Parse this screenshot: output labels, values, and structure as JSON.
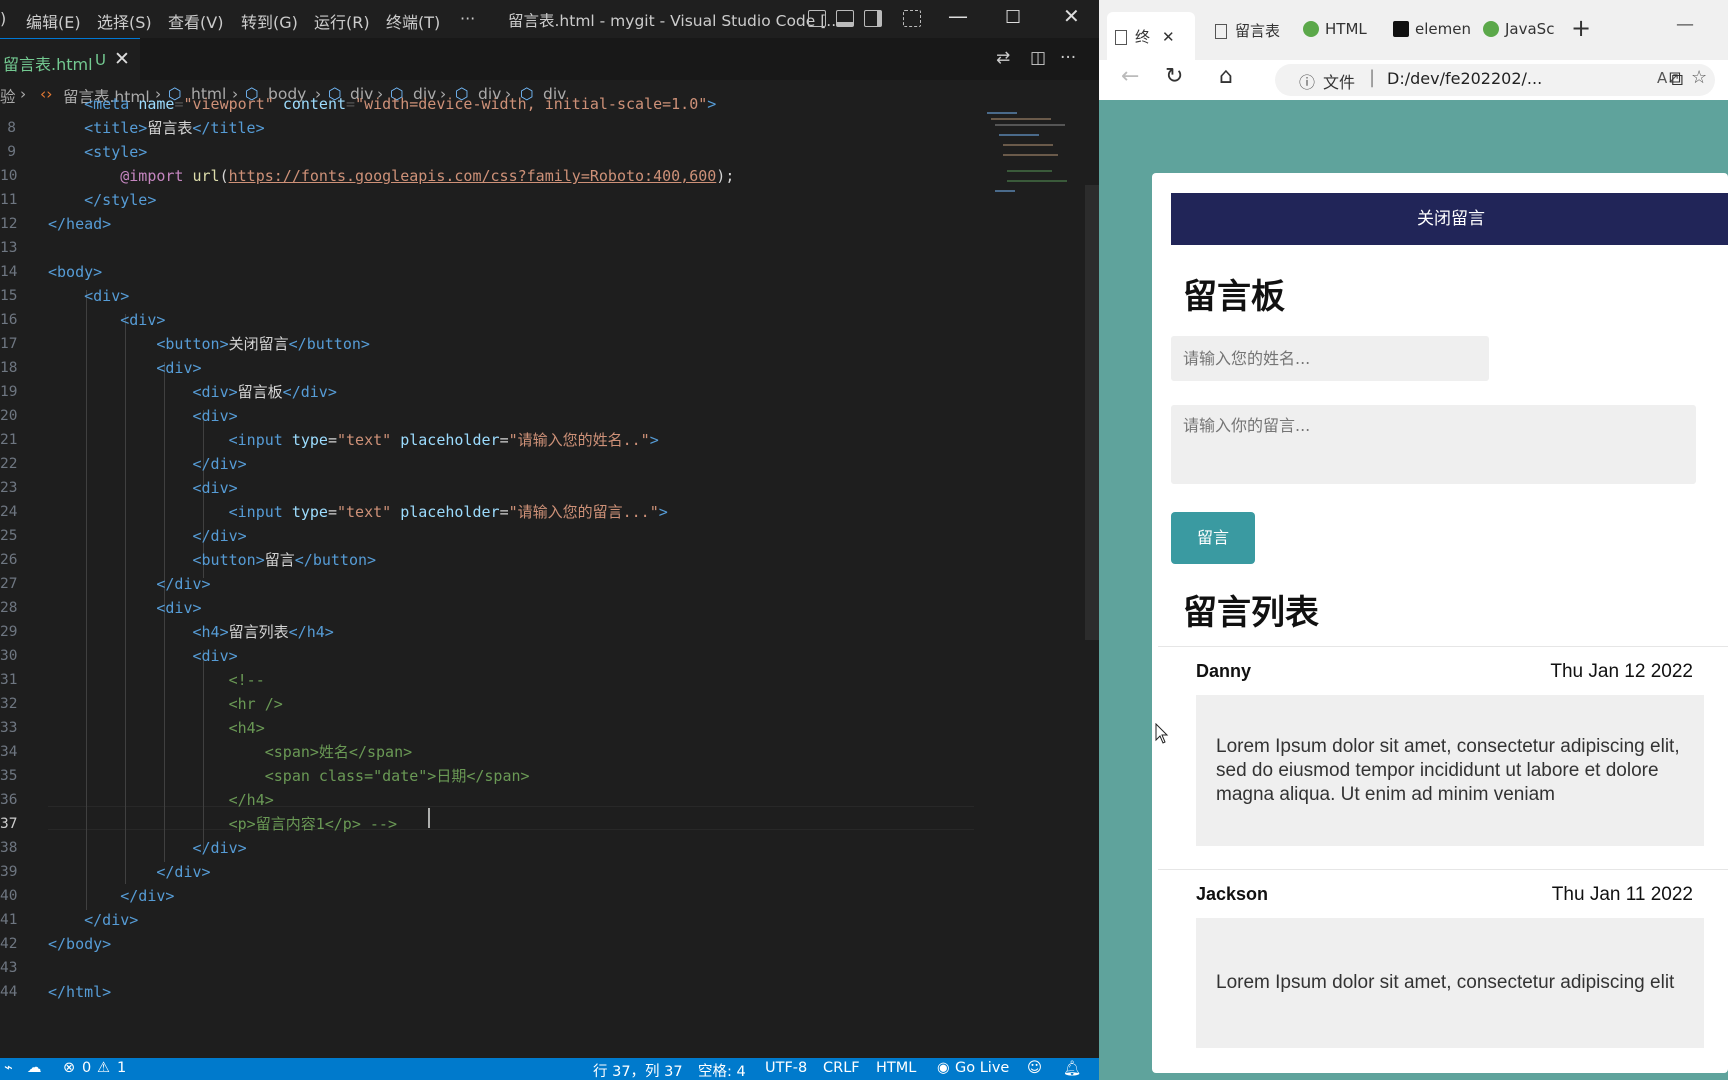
{
  "vscode": {
    "menu": [
      "编辑(E)",
      "选择(S)",
      "查看(V)",
      "转到(G)",
      "运行(R)",
      "终端(T)",
      "···"
    ],
    "window_title": "留言表.html - mygit - Visual Studio Code [...",
    "tab": {
      "label": "留言表.html",
      "status": "U",
      "close": "✕"
    },
    "breadcrumbs": [
      "验",
      "留言表.html",
      "html",
      "body",
      "div",
      "div",
      "div",
      "div"
    ],
    "line_numbers": [
      "8",
      "9",
      "10",
      "11",
      "12",
      "13",
      "14",
      "15",
      "16",
      "17",
      "18",
      "19",
      "20",
      "21",
      "22",
      "23",
      "24",
      "25",
      "26",
      "27",
      "28",
      "29",
      "30",
      "31",
      "32",
      "33",
      "34",
      "35",
      "36",
      "37",
      "38",
      "39",
      "40",
      "41",
      "42",
      "43",
      "44"
    ],
    "status": {
      "errors": "0",
      "warnings": "1",
      "position": "行 37，列 37",
      "spaces": "空格: 4",
      "encoding": "UTF-8",
      "eol": "CRLF",
      "language": "HTML",
      "golive": "Go Live"
    }
  },
  "edge": {
    "tabs": [
      "终",
      "留言表",
      "HTML",
      "elemen",
      "JavaSc"
    ],
    "address": {
      "info_label": "文件",
      "url": "D:/dev/fe202202/..."
    },
    "page": {
      "close_button": "关闭留言",
      "board_title": "留言板",
      "name_placeholder": "请输入您的姓名...",
      "message_placeholder": "请输入你的留言...",
      "submit_button": "留言",
      "list_title": "留言列表",
      "messages": [
        {
          "name": "Danny",
          "date": "Thu Jan 12 2022",
          "body": "Lorem Ipsum dolor sit amet, consectetur adipiscing elit, sed do eiusmod tempor incididunt ut labore et dolore magna aliqua. Ut enim ad minim veniam"
        },
        {
          "name": "Jackson",
          "date": "Thu Jan 11 2022",
          "body": "Lorem Ipsum dolor sit amet, consectetur adipiscing elit"
        }
      ]
    }
  }
}
